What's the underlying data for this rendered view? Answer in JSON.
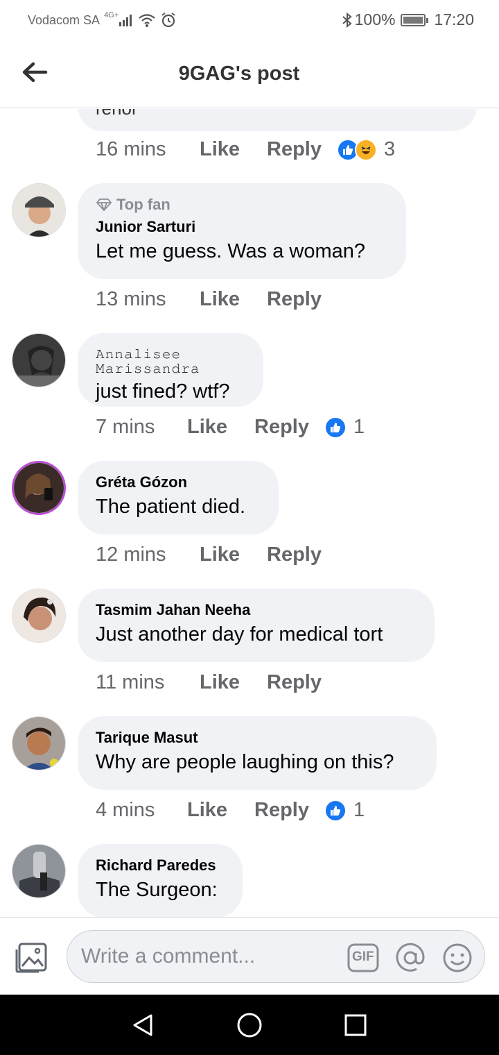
{
  "status_bar": {
    "carrier": "Vodacom SA",
    "network": "4G+",
    "battery": "100%",
    "time": "17:20"
  },
  "header": {
    "title": "9GAG's post"
  },
  "partial_comment": {
    "text_fragment": "rerior",
    "time": "16 mins",
    "like": "Like",
    "reply": "Reply",
    "reaction_count": "3"
  },
  "comments": [
    {
      "badge": "Top fan",
      "name": "Junior Sarturi",
      "text": "Let me guess. Was a woman?",
      "time": "13 mins",
      "like": "Like",
      "reply": "Reply"
    },
    {
      "name": "𝙰𝚗𝚗𝚊𝚕𝚒𝚜𝚎𝚎 𝙼𝚊𝚛𝚒𝚜𝚜𝚊𝚗𝚍𝚛𝚊",
      "text": "just fined? wtf?",
      "time": "7 mins",
      "like": "Like",
      "reply": "Reply",
      "reaction_count": "1"
    },
    {
      "name": "Gréta Gózon",
      "text": "The patient died.",
      "time": "12 mins",
      "like": "Like",
      "reply": "Reply"
    },
    {
      "name": "Tasmim Jahan Neeha",
      "text": "Just another day for medical tort",
      "time": "11 mins",
      "like": "Like",
      "reply": "Reply"
    },
    {
      "name": "Tarique Masut",
      "text": "Why are people laughing on this?",
      "time": "4 mins",
      "like": "Like",
      "reply": "Reply",
      "reaction_count": "1"
    },
    {
      "name": "Richard Paredes",
      "text": "The Surgeon:"
    }
  ],
  "composer": {
    "placeholder": "Write a comment...",
    "gif_label": "GIF"
  },
  "colors": {
    "bubble": "#f0f2f5",
    "like_blue": "#1877f2",
    "meta_gray": "#65676b"
  }
}
